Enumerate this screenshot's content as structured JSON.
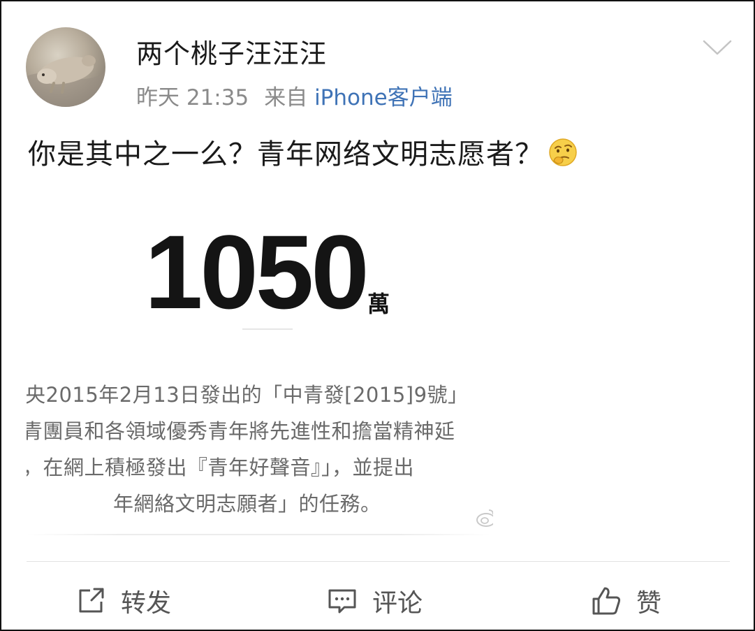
{
  "post": {
    "username": "两个桃子汪汪汪",
    "time": "昨天 21:35",
    "from_label": "来自",
    "source": "iPhone客户端",
    "text": "你是其中之一么？青年网络文明志愿者？",
    "emoji": "thinking-face-emoji"
  },
  "image_card": {
    "big_number": "1050",
    "unit": "萬",
    "lines": [
      "央2015年2月13日發出的「中青發[2015]9號」",
      "青團員和各領域優秀青年將先進性和擔當精神延",
      "，在網上積極發出『青年好聲音』」，並提出",
      "年網絡文明志願者」的任務。"
    ]
  },
  "actions": {
    "repost": "转发",
    "comment": "评论",
    "like": "赞"
  }
}
